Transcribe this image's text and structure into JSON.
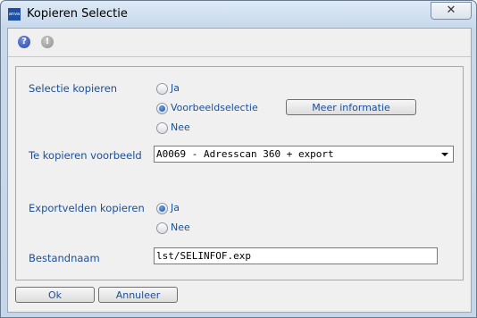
{
  "window": {
    "title": "Kopieren Selectie",
    "app_icon_text": "anva"
  },
  "toolbar": {
    "help_icon": "help-icon",
    "info_icon": "info-icon"
  },
  "form": {
    "selectie_kopieren": {
      "label": "Selectie kopieren",
      "options": [
        {
          "label": "Ja",
          "checked": false
        },
        {
          "label": "Voorbeeldselectie",
          "checked": true
        },
        {
          "label": "Nee",
          "checked": false
        }
      ],
      "meer_informatie_label": "Meer informatie"
    },
    "te_kopieren_voorbeeld": {
      "label": "Te kopieren voorbeeld",
      "selected": "A0069 - Adresscan 360 + export"
    },
    "exportvelden_kopieren": {
      "label": "Exportvelden kopieren",
      "options": [
        {
          "label": "Ja",
          "checked": true
        },
        {
          "label": "Nee",
          "checked": false
        }
      ]
    },
    "bestandnaam": {
      "label": "Bestandnaam",
      "value": "lst/SELINFOF.exp"
    }
  },
  "footer": {
    "ok_label": "Ok",
    "cancel_label": "Annuleer"
  }
}
